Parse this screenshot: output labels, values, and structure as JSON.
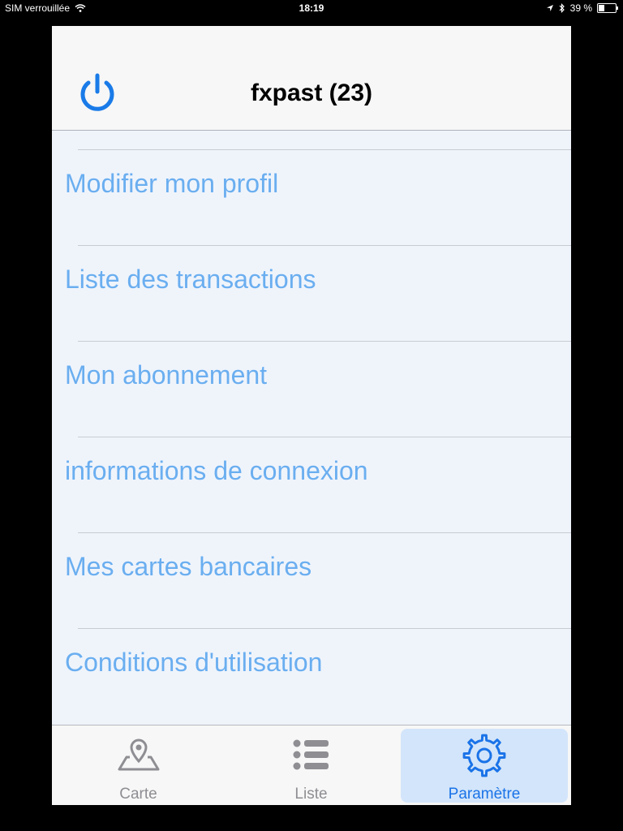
{
  "status_bar": {
    "carrier": "SIM verrouillée",
    "time": "18:19",
    "battery_percent": "39 %",
    "battery_level": 0.39,
    "icons": [
      "wifi-icon",
      "location-icon",
      "bluetooth-icon",
      "battery-icon"
    ]
  },
  "header": {
    "title": "fxpast (23)",
    "power_icon": "power-icon"
  },
  "menu": {
    "items": [
      {
        "label": "Modifier mon profil"
      },
      {
        "label": "Liste des transactions"
      },
      {
        "label": "Mon abonnement"
      },
      {
        "label": "informations de connexion"
      },
      {
        "label": "Mes cartes bancaires"
      },
      {
        "label": "Conditions d'utilisation"
      }
    ]
  },
  "tabbar": {
    "tabs": [
      {
        "label": "Carte",
        "icon": "map-pin-icon",
        "selected": false
      },
      {
        "label": "Liste",
        "icon": "list-icon",
        "selected": false
      },
      {
        "label": "Paramètre",
        "icon": "gear-icon",
        "selected": true
      }
    ]
  },
  "colors": {
    "accent": "#1a73e8",
    "menu_text": "#6aaef0",
    "menu_background": "#eff4fb",
    "selected_tab_bg": "#d3e5fa"
  }
}
